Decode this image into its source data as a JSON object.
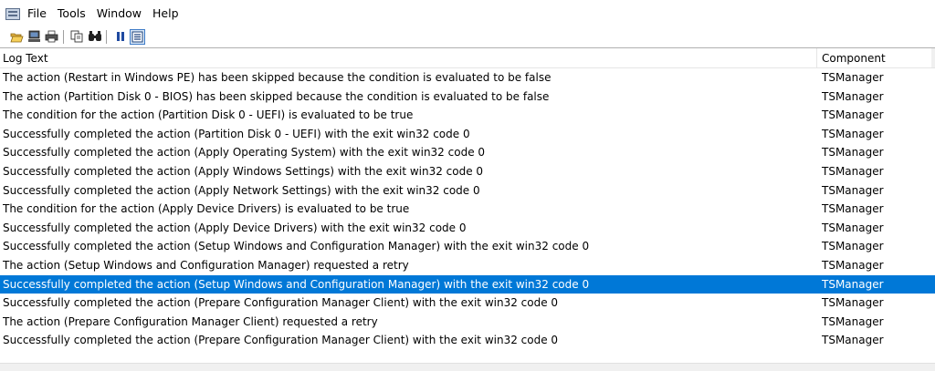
{
  "menu": {
    "items": [
      {
        "label": "File"
      },
      {
        "label": "Tools"
      },
      {
        "label": "Window"
      },
      {
        "label": "Help"
      }
    ]
  },
  "toolbar": {
    "buttons": [
      {
        "icon": "open-folder-icon"
      },
      {
        "icon": "computer-icon"
      },
      {
        "icon": "printer-icon"
      },
      {
        "icon": "copy-icon"
      },
      {
        "icon": "find-icon"
      },
      {
        "icon": "pause-icon"
      },
      {
        "icon": "list-view-icon"
      }
    ]
  },
  "log": {
    "columns": [
      "Log Text",
      "Component"
    ],
    "selected_index": 11,
    "rows": [
      {
        "text": "The action (Restart in Windows PE) has been skipped because the condition is evaluated to be false",
        "component": "TSManager"
      },
      {
        "text": "The action (Partition Disk 0 - BIOS) has been skipped because the condition is evaluated to be false",
        "component": "TSManager"
      },
      {
        "text": "The condition for the action (Partition Disk 0 - UEFI) is evaluated to be true",
        "component": "TSManager"
      },
      {
        "text": "Successfully completed the action (Partition Disk 0 - UEFI) with the exit win32 code 0",
        "component": "TSManager"
      },
      {
        "text": "Successfully completed the action (Apply Operating System) with the exit win32 code 0",
        "component": "TSManager"
      },
      {
        "text": "Successfully completed the action (Apply Windows Settings) with the exit win32 code 0",
        "component": "TSManager"
      },
      {
        "text": "Successfully completed the action (Apply Network Settings) with the exit win32 code 0",
        "component": "TSManager"
      },
      {
        "text": "The condition for the action (Apply Device Drivers) is evaluated to be true",
        "component": "TSManager"
      },
      {
        "text": "Successfully completed the action (Apply Device Drivers) with the exit win32 code 0",
        "component": "TSManager"
      },
      {
        "text": "Successfully completed the action (Setup Windows and Configuration Manager) with the exit win32 code 0",
        "component": "TSManager"
      },
      {
        "text": "The action (Setup Windows and Configuration Manager) requested a retry",
        "component": "TSManager"
      },
      {
        "text": "Successfully completed the action (Setup Windows and Configuration Manager) with the exit win32 code 0",
        "component": "TSManager"
      },
      {
        "text": "Successfully completed the action (Prepare Configuration Manager Client) with the exit win32 code 0",
        "component": "TSManager"
      },
      {
        "text": "The action (Prepare Configuration Manager Client) requested a retry",
        "component": "TSManager"
      },
      {
        "text": "Successfully completed the action (Prepare Configuration Manager Client) with the exit win32 code 0",
        "component": "TSManager"
      }
    ]
  },
  "colors": {
    "selection": "#0078d7",
    "selection_text": "#ffffff"
  }
}
